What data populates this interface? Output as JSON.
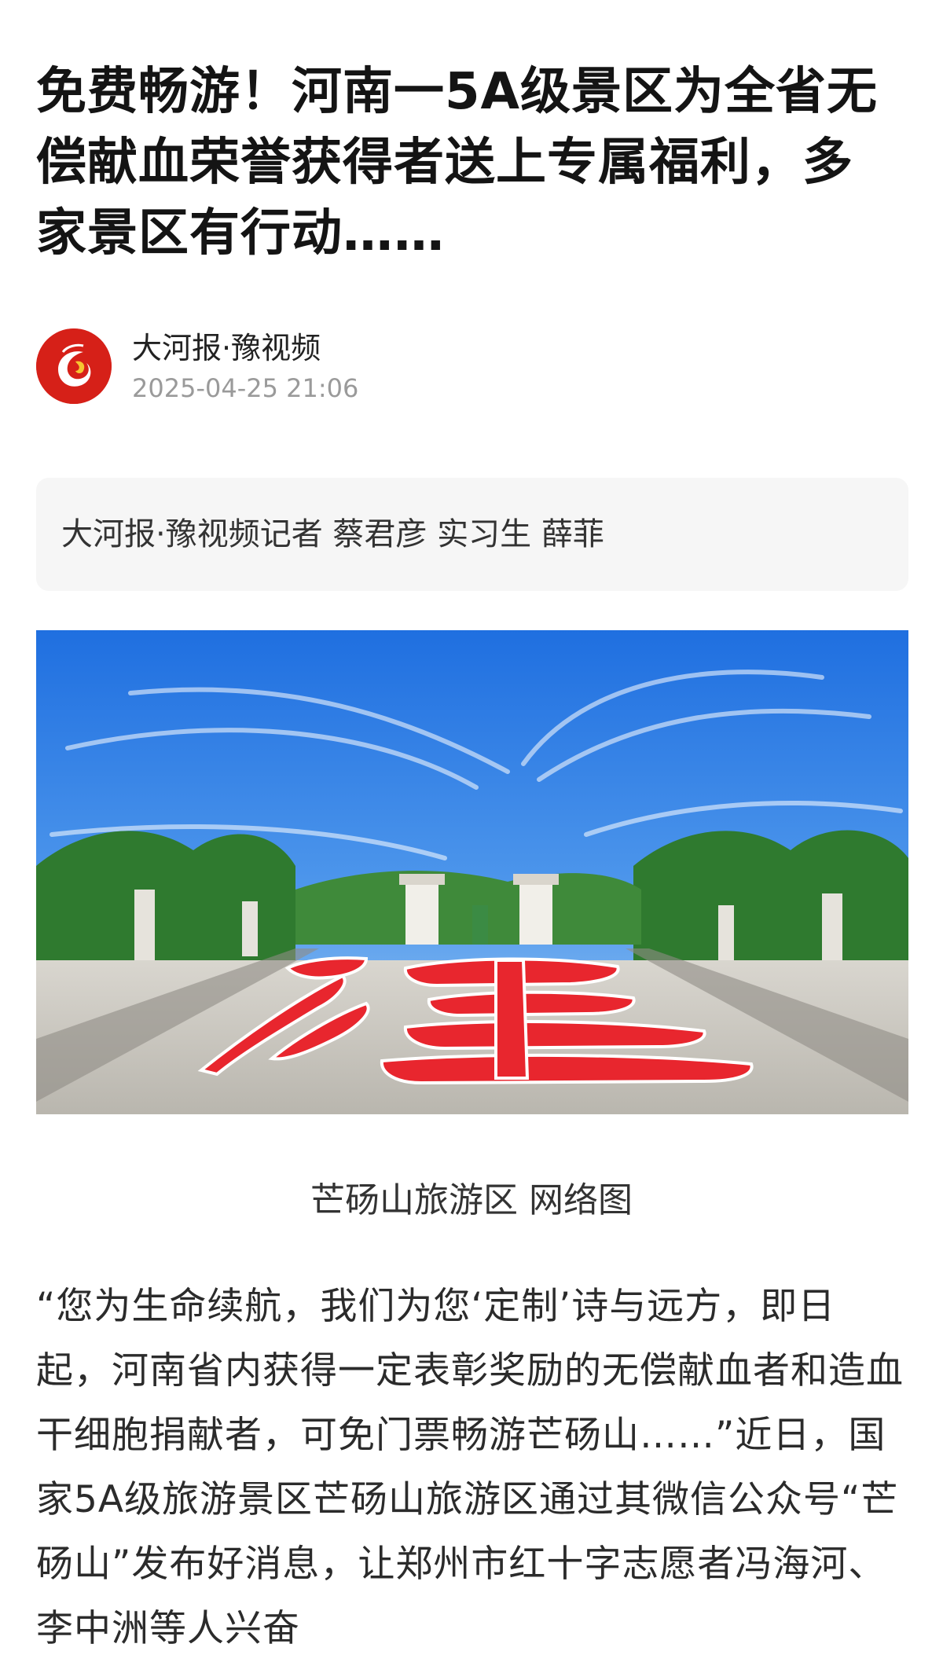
{
  "article": {
    "title": "免费畅游！河南一5A级景区为全省无偿献血荣誉获得者送上专属福利，多家景区有行动……",
    "author": {
      "name": "大河报·豫视频",
      "timestamp": "2025-04-25 21:06",
      "avatar_icon": "dahe-logo-icon",
      "avatar_color": "#d62018"
    },
    "byline": "大河报·豫视频记者 蔡君彦 实习生 薛菲",
    "image": {
      "caption": "芒砀山旅游区 网络图"
    },
    "body": "“您为生命续航，我们为您‘定制’诗与远方，即日起，河南省内获得一定表彰奖励的无偿献血者和造血干细胞捐献者，可免门票畅游芒砀山……”近日，国家5A级旅游景区芒砀山旅游区通过其微信公众号“芒砀山”发布好消息，让郑州市红十字志愿者冯海河、李中洲等人兴奋"
  }
}
